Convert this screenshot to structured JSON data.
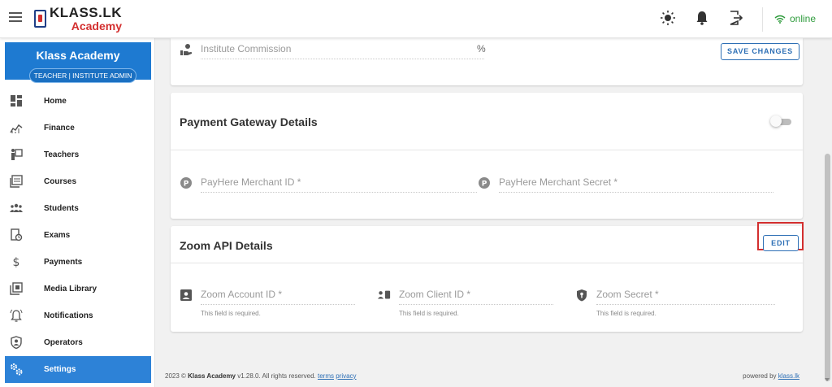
{
  "header": {
    "logo_top": "KLASS.LK",
    "logo_bottom": "Academy",
    "status": "online"
  },
  "sidebar": {
    "institute_name": "Klass Academy",
    "role": "TEACHER | INSTITUTE ADMIN",
    "items": [
      {
        "label": "Home",
        "icon": "dashboard-icon"
      },
      {
        "label": "Finance",
        "icon": "finance-icon"
      },
      {
        "label": "Teachers",
        "icon": "teacher-icon"
      },
      {
        "label": "Courses",
        "icon": "courses-icon"
      },
      {
        "label": "Students",
        "icon": "students-icon"
      },
      {
        "label": "Exams",
        "icon": "exams-icon"
      },
      {
        "label": "Payments",
        "icon": "dollar-icon"
      },
      {
        "label": "Media Library",
        "icon": "media-library-icon"
      },
      {
        "label": "Notifications",
        "icon": "notification-bell-icon"
      },
      {
        "label": "Operators",
        "icon": "shield-user-icon"
      },
      {
        "label": "Settings",
        "icon": "cogs-icon",
        "active": true
      }
    ]
  },
  "commission_card": {
    "field_label": "Institute Commission",
    "suffix": "%",
    "save_label": "SAVE CHANGES"
  },
  "payment_gateway": {
    "title": "Payment Gateway Details",
    "toggle_on": false,
    "merchant_id_placeholder": "PayHere Merchant ID *",
    "merchant_secret_placeholder": "PayHere Merchant Secret *"
  },
  "zoom_api": {
    "title": "Zoom API Details",
    "edit_label": "EDIT",
    "account_id_placeholder": "Zoom Account ID *",
    "client_id_placeholder": "Zoom Client ID *",
    "secret_placeholder": "Zoom Secret *",
    "required_text": "This field is required."
  },
  "footer": {
    "year": "2023 ©",
    "brand": "Klass Academy",
    "version_text": "v1.28.0. All rights reserved.",
    "terms": "terms",
    "privacy": "privacy",
    "powered_by": "powered by",
    "powered_link": "klass.lk"
  },
  "colors": {
    "primary": "#2d82d7",
    "online": "#2e9b3c",
    "highlight": "#d32f2f"
  }
}
